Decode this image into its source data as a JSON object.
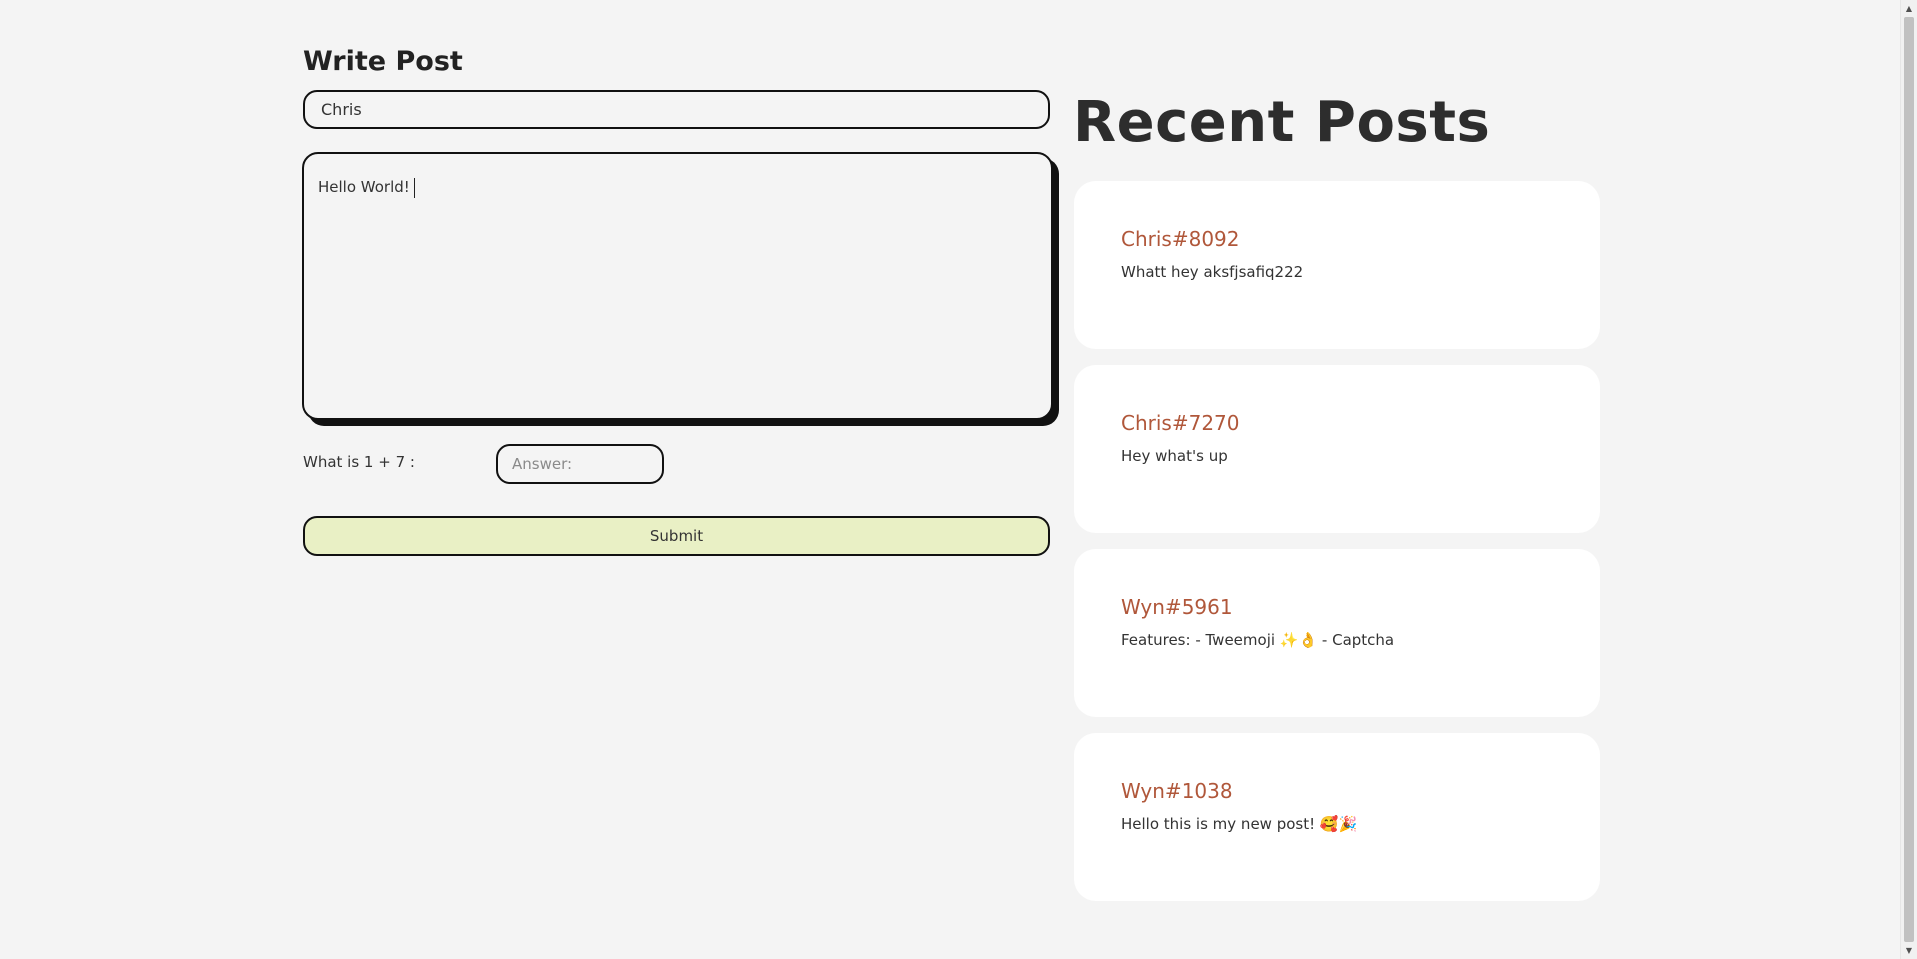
{
  "write": {
    "title": "Write Post",
    "name_value": "Chris",
    "post_value": "Hello World!",
    "captcha_label": "What is 1 + 7 :",
    "answer_placeholder": "Answer:",
    "submit_label": "Submit"
  },
  "recent": {
    "title": "Recent Posts",
    "posts": [
      {
        "author": "Chris#8092",
        "body": "Whatt hey aksfjsafiq222"
      },
      {
        "author": "Chris#7270",
        "body": "Hey what's up"
      },
      {
        "author": "Wyn#5961",
        "body": "Features: - Tweemoji ✨👌 - Captcha"
      },
      {
        "author": "Wyn#1038",
        "body": "Hello this is my new post! 🥰🎉"
      }
    ]
  },
  "colors": {
    "background": "#f4f4f4",
    "author": "#b0573a",
    "submit_bg": "#e9f0c5",
    "card_bg": "#ffffff"
  }
}
